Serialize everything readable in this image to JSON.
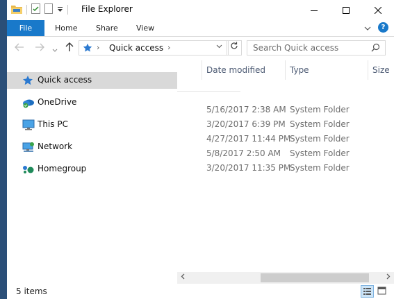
{
  "window": {
    "title": "File Explorer",
    "controls": [
      "minimize",
      "maximize",
      "close"
    ]
  },
  "ribbon": {
    "tabs": [
      {
        "label": "File",
        "active": true
      },
      {
        "label": "Home"
      },
      {
        "label": "Share"
      },
      {
        "label": "View"
      }
    ],
    "help_label": "?"
  },
  "address_bar": {
    "location": "Quick access",
    "refresh_icon": "refresh-icon"
  },
  "search": {
    "placeholder": "Search Quick access"
  },
  "nav_pane": {
    "items": [
      {
        "label": "Quick access",
        "icon": "star-icon",
        "selected": true
      },
      {
        "label": "OneDrive",
        "icon": "cloud-icon"
      },
      {
        "label": "This PC",
        "icon": "monitor-icon"
      },
      {
        "label": "Network",
        "icon": "network-icon"
      },
      {
        "label": "Homegroup",
        "icon": "homegroup-icon"
      }
    ]
  },
  "columns": {
    "date_modified": "Date modified",
    "type": "Type",
    "size": "Size"
  },
  "rows": [
    {
      "date": "5/16/2017 2:38 AM",
      "type": "System Folder"
    },
    {
      "date": "3/20/2017 6:39 PM",
      "type": "System Folder"
    },
    {
      "date": "4/27/2017 11:44 PM",
      "type": "System Folder"
    },
    {
      "date": "5/8/2017 2:50 AM",
      "type": "System Folder"
    },
    {
      "date": "3/20/2017 11:35 PM",
      "type": "System Folder"
    }
  ],
  "status": {
    "item_count": "5 items"
  },
  "colors": {
    "accent": "#1979ca",
    "desktop": "#2b4f78",
    "selection": "#d9d9d9"
  }
}
